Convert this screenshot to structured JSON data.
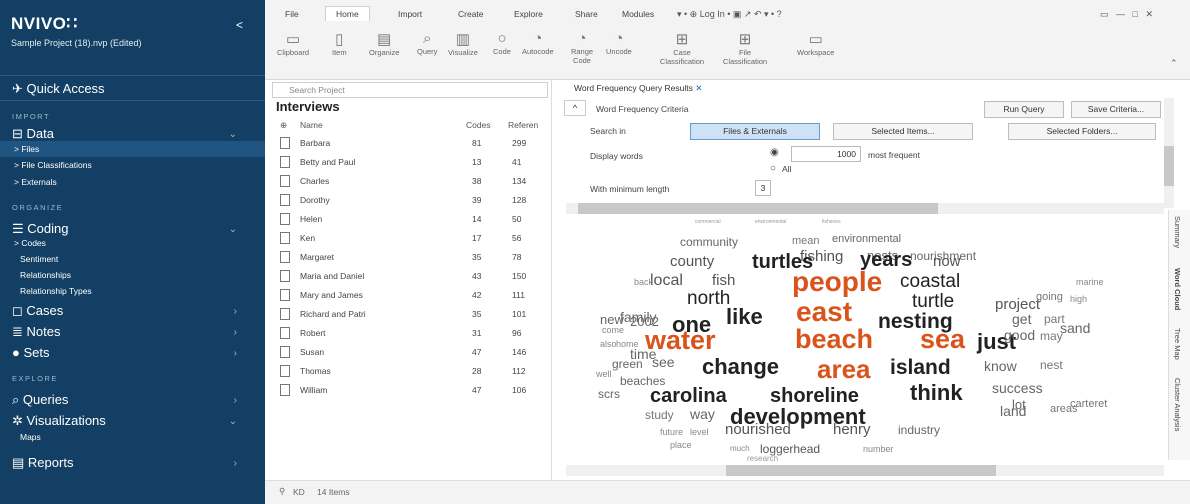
{
  "sidebar": {
    "logo": "NVIVO∷",
    "project": "Sample Project (18).nvp (Edited)",
    "collapse": "<",
    "quick_access": "Quick Access",
    "sections": {
      "import": "IMPORT",
      "organize": "ORGANIZE",
      "explore": "EXPLORE"
    },
    "data": "Data",
    "data_items": [
      "> Files",
      "> File Classifications",
      "> Externals"
    ],
    "coding": "Coding",
    "coding_items": [
      "> Codes",
      "Sentiment",
      "Relationships",
      "Relationship Types"
    ],
    "cases": "Cases",
    "notes": "Notes",
    "sets": "Sets",
    "queries": "Queries",
    "visualizations": "Visualizations",
    "maps": "Maps",
    "reports": "Reports"
  },
  "ribbon": {
    "tabs": [
      "File",
      "Home",
      "Import",
      "Create",
      "Explore",
      "Share",
      "Modules"
    ],
    "login": "Log In",
    "buttons": [
      "Clipboard",
      "Item",
      "Organize",
      "Query",
      "Visualize",
      "Code",
      "Autocode",
      "Range Code",
      "Uncode",
      "Case Classification",
      "File Classification",
      "Workspace"
    ]
  },
  "project_list": {
    "search_placeholder": "Search Project",
    "title": "Interviews",
    "columns": [
      "Name",
      "Codes",
      "Referen"
    ],
    "rows": [
      {
        "name": "Barbara",
        "codes": "81",
        "refs": "299"
      },
      {
        "name": "Betty and Paul",
        "codes": "13",
        "refs": "41"
      },
      {
        "name": "Charles",
        "codes": "38",
        "refs": "134"
      },
      {
        "name": "Dorothy",
        "codes": "39",
        "refs": "128"
      },
      {
        "name": "Helen",
        "codes": "14",
        "refs": "50"
      },
      {
        "name": "Ken",
        "codes": "17",
        "refs": "56"
      },
      {
        "name": "Margaret",
        "codes": "35",
        "refs": "78"
      },
      {
        "name": "Maria and Daniel",
        "codes": "43",
        "refs": "150"
      },
      {
        "name": "Mary and James",
        "codes": "42",
        "refs": "111"
      },
      {
        "name": "Richard and Patri",
        "codes": "35",
        "refs": "101"
      },
      {
        "name": "Robert",
        "codes": "31",
        "refs": "96"
      },
      {
        "name": "Susan",
        "codes": "47",
        "refs": "146"
      },
      {
        "name": "Thomas",
        "codes": "28",
        "refs": "112"
      },
      {
        "name": "William",
        "codes": "47",
        "refs": "106"
      }
    ]
  },
  "status": {
    "user": "KD",
    "count": "14 Items"
  },
  "query": {
    "tab_title": "Word Frequency Query Results",
    "criteria": "Word Frequency Criteria",
    "run_query": "Run Query",
    "save_criteria": "Save Criteria...",
    "search_in": "Search in",
    "files_externals": "Files & Externals",
    "selected_items": "Selected Items...",
    "selected_folders": "Selected Folders...",
    "display_words": "Display words",
    "count": "1000",
    "most_frequent": "most frequent",
    "all": "All",
    "min_length": "With minimum length",
    "min_length_value": "3",
    "side_tabs": [
      "Summary",
      "Word Cloud",
      "Tree Map",
      "Cluster Analysis"
    ]
  },
  "word_cloud": [
    {
      "t": "commercial",
      "s": 5,
      "c": "#999"
    },
    {
      "t": "environmental",
      "s": 5,
      "c": "#999"
    },
    {
      "t": "fisheries",
      "s": 5,
      "c": "#999"
    },
    {
      "t": "community",
      "s": 12,
      "c": "#666"
    },
    {
      "t": "mean",
      "s": 11,
      "c": "#777"
    },
    {
      "t": "environmental",
      "s": 11,
      "c": "#666"
    },
    {
      "t": "fishing",
      "s": 15,
      "c": "#555"
    },
    {
      "t": "nests",
      "s": 13,
      "c": "#666"
    },
    {
      "t": "nourishment",
      "s": 12,
      "c": "#666"
    },
    {
      "t": "county",
      "s": 15,
      "c": "#555"
    },
    {
      "t": "turtles",
      "s": 20,
      "c": "#222"
    },
    {
      "t": "years",
      "s": 20,
      "c": "#222"
    },
    {
      "t": "now",
      "s": 15,
      "c": "#555"
    },
    {
      "t": "local",
      "s": 16,
      "c": "#555"
    },
    {
      "t": "fish",
      "s": 15,
      "c": "#555"
    },
    {
      "t": "coastal",
      "s": 19,
      "c": "#222"
    },
    {
      "t": "people",
      "s": 28,
      "c": "#d9541b"
    },
    {
      "t": "north",
      "s": 19,
      "c": "#222"
    },
    {
      "t": "turtle",
      "s": 19,
      "c": "#222"
    },
    {
      "t": "project",
      "s": 15,
      "c": "#555"
    },
    {
      "t": "family",
      "s": 14,
      "c": "#666"
    },
    {
      "t": "east",
      "s": 28,
      "c": "#d9541b"
    },
    {
      "t": "like",
      "s": 22,
      "c": "#222"
    },
    {
      "t": "nesting",
      "s": 21,
      "c": "#222"
    },
    {
      "t": "one",
      "s": 22,
      "c": "#222"
    },
    {
      "t": "2002",
      "s": 13,
      "c": "#666"
    },
    {
      "t": "get",
      "s": 14,
      "c": "#666"
    },
    {
      "t": "part",
      "s": 12,
      "c": "#777"
    },
    {
      "t": "water",
      "s": 27,
      "c": "#d9541b"
    },
    {
      "t": "beach",
      "s": 27,
      "c": "#d9541b"
    },
    {
      "t": "sea",
      "s": 27,
      "c": "#d9541b"
    },
    {
      "t": "just",
      "s": 22,
      "c": "#222"
    },
    {
      "t": "time",
      "s": 14,
      "c": "#666"
    },
    {
      "t": "good",
      "s": 14,
      "c": "#666"
    },
    {
      "t": "may",
      "s": 12,
      "c": "#777"
    },
    {
      "t": "sand",
      "s": 14,
      "c": "#666"
    },
    {
      "t": "green",
      "s": 12,
      "c": "#666"
    },
    {
      "t": "see",
      "s": 14,
      "c": "#666"
    },
    {
      "t": "change",
      "s": 22,
      "c": "#222"
    },
    {
      "t": "area",
      "s": 26,
      "c": "#d9541b"
    },
    {
      "t": "island",
      "s": 21,
      "c": "#222"
    },
    {
      "t": "know",
      "s": 14,
      "c": "#666"
    },
    {
      "t": "nest",
      "s": 12,
      "c": "#777"
    },
    {
      "t": "beaches",
      "s": 12,
      "c": "#666"
    },
    {
      "t": "scrs",
      "s": 12,
      "c": "#666"
    },
    {
      "t": "carolina",
      "s": 20,
      "c": "#222"
    },
    {
      "t": "shoreline",
      "s": 20,
      "c": "#222"
    },
    {
      "t": "think",
      "s": 22,
      "c": "#222"
    },
    {
      "t": "success",
      "s": 14,
      "c": "#666"
    },
    {
      "t": "study",
      "s": 12,
      "c": "#777"
    },
    {
      "t": "way",
      "s": 14,
      "c": "#666"
    },
    {
      "t": "development",
      "s": 22,
      "c": "#222"
    },
    {
      "t": "land",
      "s": 14,
      "c": "#666"
    },
    {
      "t": "areas",
      "s": 11,
      "c": "#777"
    },
    {
      "t": "lot",
      "s": 13,
      "c": "#666"
    },
    {
      "t": "carteret",
      "s": 11,
      "c": "#777"
    },
    {
      "t": "future",
      "s": 9,
      "c": "#888"
    },
    {
      "t": "level",
      "s": 9,
      "c": "#888"
    },
    {
      "t": "nourished",
      "s": 15,
      "c": "#555"
    },
    {
      "t": "henry",
      "s": 15,
      "c": "#555"
    },
    {
      "t": "industry",
      "s": 12,
      "c": "#666"
    },
    {
      "t": "place",
      "s": 9,
      "c": "#888"
    },
    {
      "t": "much",
      "s": 8,
      "c": "#888"
    },
    {
      "t": "loggerhead",
      "s": 12,
      "c": "#555"
    },
    {
      "t": "number",
      "s": 9,
      "c": "#888"
    },
    {
      "t": "research",
      "s": 8,
      "c": "#999"
    },
    {
      "t": "home",
      "s": 9,
      "c": "#888"
    },
    {
      "t": "new",
      "s": 13,
      "c": "#666"
    },
    {
      "t": "back",
      "s": 9,
      "c": "#888"
    },
    {
      "t": "come",
      "s": 9,
      "c": "#888"
    },
    {
      "t": "going",
      "s": 11,
      "c": "#777"
    },
    {
      "t": "high",
      "s": 9,
      "c": "#888"
    },
    {
      "t": "also",
      "s": 9,
      "c": "#888"
    },
    {
      "t": "well",
      "s": 9,
      "c": "#888"
    },
    {
      "t": "marine",
      "s": 9,
      "c": "#888"
    }
  ]
}
